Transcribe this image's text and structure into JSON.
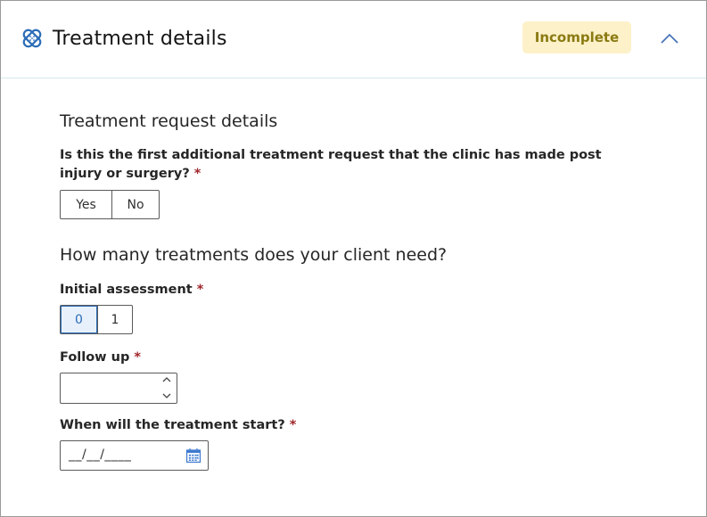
{
  "header": {
    "icon": "bandage-icon",
    "title": "Treatment details",
    "status_badge": "Incomplete",
    "collapse_icon": "chevron-up-icon"
  },
  "section1": {
    "title": "Treatment request details",
    "question": "Is this the first additional treatment request that the clinic has made post injury or surgery?",
    "required_mark": "*",
    "options": [
      "Yes",
      "No"
    ],
    "selected": null
  },
  "section2": {
    "title": "How many treatments does your client need?",
    "initial_assessment": {
      "label": "Initial assessment",
      "required_mark": "*",
      "options": [
        "0",
        "1"
      ],
      "selected": "0"
    },
    "follow_up": {
      "label": "Follow up",
      "required_mark": "*",
      "value": ""
    },
    "start_date": {
      "label": "When will the treatment start?",
      "required_mark": "*",
      "placeholder": "__/__/____",
      "icon": "calendar-icon"
    }
  },
  "colors": {
    "accent": "#2a6cb8",
    "badge_bg": "#fdf1c9",
    "badge_text": "#8a7a12",
    "required": "#a0262b"
  }
}
